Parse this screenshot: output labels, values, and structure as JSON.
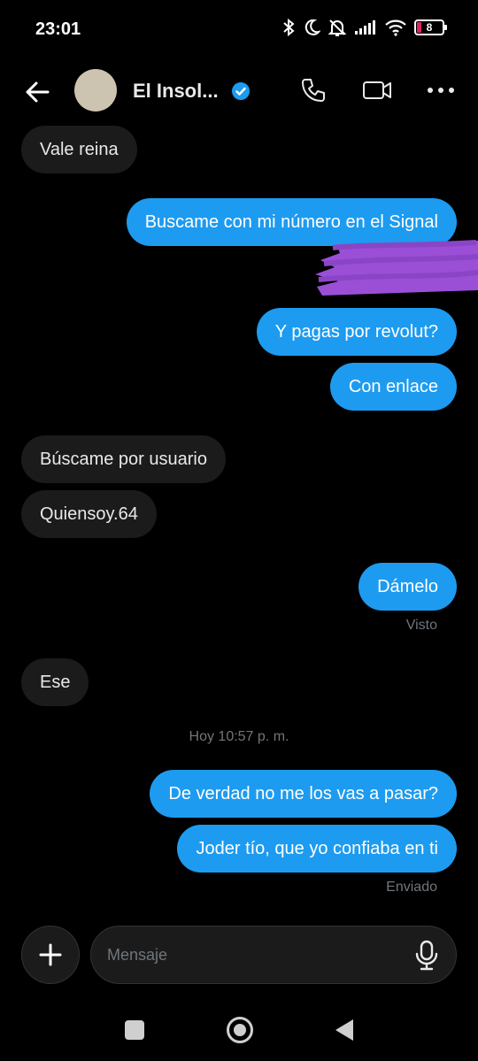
{
  "status_bar": {
    "time": "23:01",
    "battery_level": "8",
    "icons": [
      "bluetooth-icon",
      "moon-icon",
      "bell-off-icon",
      "signal-icon",
      "wifi-icon",
      "battery-icon"
    ]
  },
  "header": {
    "contact_name": "El Insol...",
    "verified": true,
    "actions": [
      "back-arrow-icon",
      "phone-icon",
      "video-icon",
      "more-icon"
    ]
  },
  "messages": [
    {
      "side": "in",
      "text": "Vale reina"
    },
    {
      "side": "out",
      "text": "Buscame con mi número en el Signal"
    },
    {
      "side": "out",
      "text": "",
      "redacted": true
    },
    {
      "side": "out",
      "text": "Y pagas por revolut?"
    },
    {
      "side": "out",
      "text": "Con enlace"
    },
    {
      "side": "in",
      "text": "Búscame por usuario"
    },
    {
      "side": "in",
      "text": "Quiensoy.64"
    },
    {
      "side": "out",
      "text": "Dámelo"
    },
    {
      "side": "in",
      "text": "Ese"
    },
    {
      "side": "out",
      "text": "De verdad no me los vas a pasar?"
    },
    {
      "side": "out",
      "text": "Joder tío, que yo confiaba en ti"
    }
  ],
  "status": {
    "seen": "Visto",
    "timestamp": "Hoy 10:57 p. m.",
    "sent": "Enviado"
  },
  "composer": {
    "placeholder": "Mensaje"
  },
  "colors": {
    "accent": "#1d9bf0",
    "incoming_bubble": "#1b1b1b",
    "redaction": "#9a4fd6"
  }
}
